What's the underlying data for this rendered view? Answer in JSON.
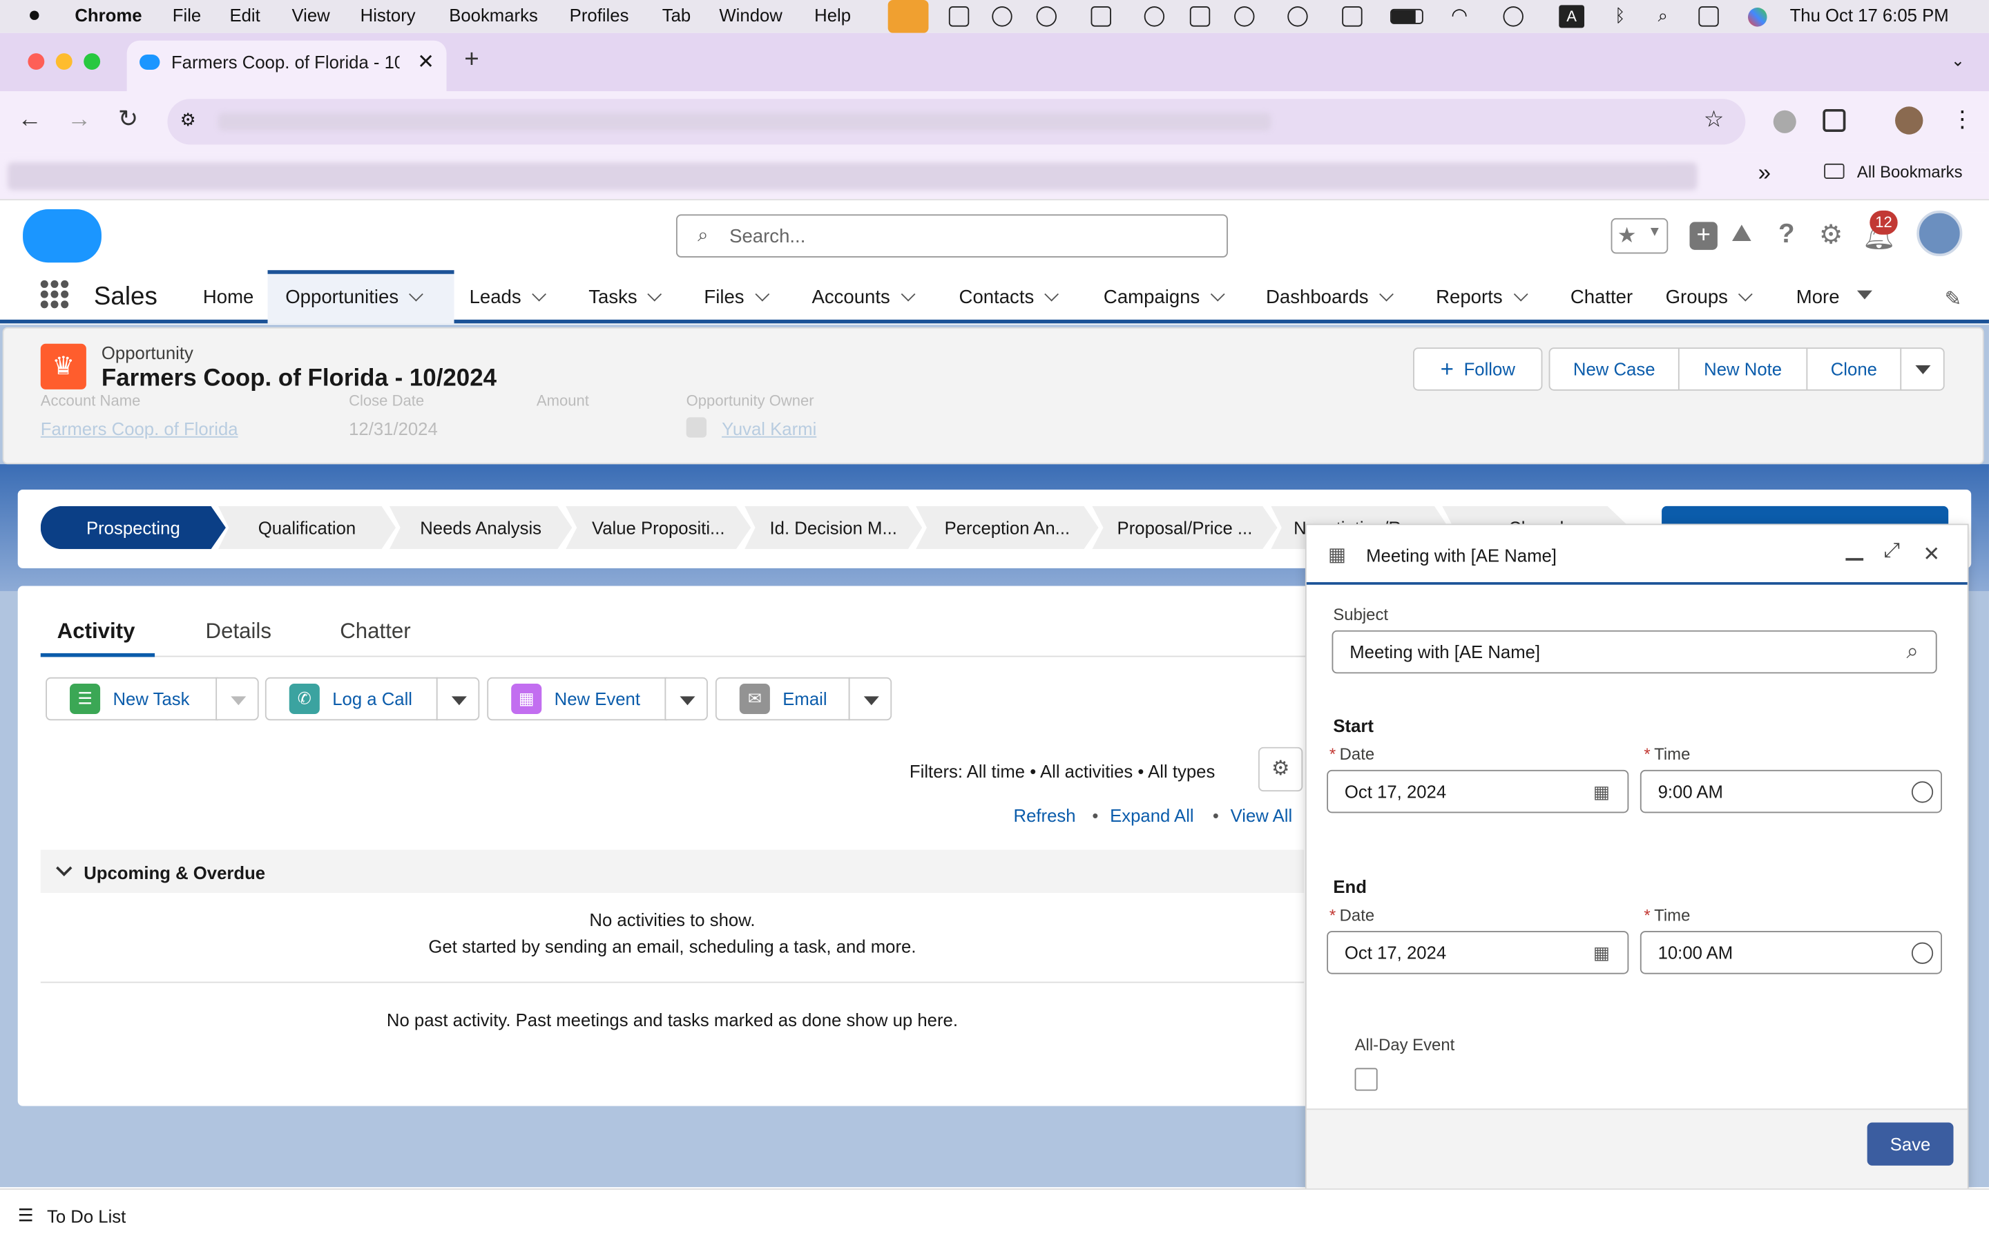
{
  "menubar": {
    "apple": "",
    "app": "Chrome",
    "items": [
      "File",
      "Edit",
      "View",
      "History",
      "Bookmarks",
      "Profiles",
      "Tab",
      "Window",
      "Help"
    ],
    "datetime": "Thu Oct 17  6:05 PM"
  },
  "browser": {
    "tab_title": "Farmers Coop. of Florida - 10/",
    "new_tab": "+",
    "bookmarks_overflow": "»",
    "all_bookmarks": "All Bookmarks"
  },
  "sf": {
    "app_name": "Sales",
    "search_placeholder": "Search...",
    "notif_count": "12",
    "nav": [
      {
        "label": "Home"
      },
      {
        "label": "Opportunities"
      },
      {
        "label": "Leads"
      },
      {
        "label": "Tasks"
      },
      {
        "label": "Files"
      },
      {
        "label": "Accounts"
      },
      {
        "label": "Contacts"
      },
      {
        "label": "Campaigns"
      },
      {
        "label": "Dashboards"
      },
      {
        "label": "Reports"
      },
      {
        "label": "Chatter"
      },
      {
        "label": "Groups"
      },
      {
        "label": "More"
      }
    ]
  },
  "record": {
    "object": "Opportunity",
    "title": "Farmers Coop. of Florida - 10/2024",
    "fields": {
      "account_label": "Account Name",
      "account_value": "Farmers Coop. of Florida",
      "close_label": "Close Date",
      "close_value": "12/31/2024",
      "amount_label": "Amount",
      "owner_label": "Opportunity Owner",
      "owner_value": "Yuval Karmi"
    },
    "buttons": {
      "follow": "Follow",
      "new_case": "New Case",
      "new_note": "New Note",
      "clone": "Clone"
    }
  },
  "path": {
    "stages": [
      "Prospecting",
      "Qualification",
      "Needs Analysis",
      "Value Propositi...",
      "Id. Decision M...",
      "Perception An...",
      "Proposal/Price ...",
      "Negotiation/Re...",
      "Closed"
    ]
  },
  "activity": {
    "tabs": [
      "Activity",
      "Details",
      "Chatter"
    ],
    "actions": {
      "new_task": "New Task",
      "log_call": "Log a Call",
      "new_event": "New Event",
      "email": "Email"
    },
    "filters": "Filters: All time • All activities • All types",
    "refresh": "Refresh",
    "expand_all": "Expand All",
    "view_all": "View All",
    "sep": "•",
    "upcoming": "Upcoming & Overdue",
    "no_activities": "No activities to show.",
    "get_started": "Get started by sending an email, scheduling a task, and more.",
    "no_past": "No past activity. Past meetings and tasks marked as done show up here."
  },
  "modal": {
    "title": "Meeting with [AE Name]",
    "subject_label": "Subject",
    "subject_value": "Meeting with [AE Name]",
    "start_label": "Start",
    "end_label": "End",
    "date_label": "Date",
    "time_label": "Time",
    "req": "*",
    "start_date": "Oct 17, 2024",
    "start_time": "9:00 AM",
    "end_date": "Oct 17, 2024",
    "end_time": "10:00 AM",
    "all_day_label": "All-Day Event",
    "save": "Save"
  },
  "footer": {
    "todo": "To Do List"
  }
}
